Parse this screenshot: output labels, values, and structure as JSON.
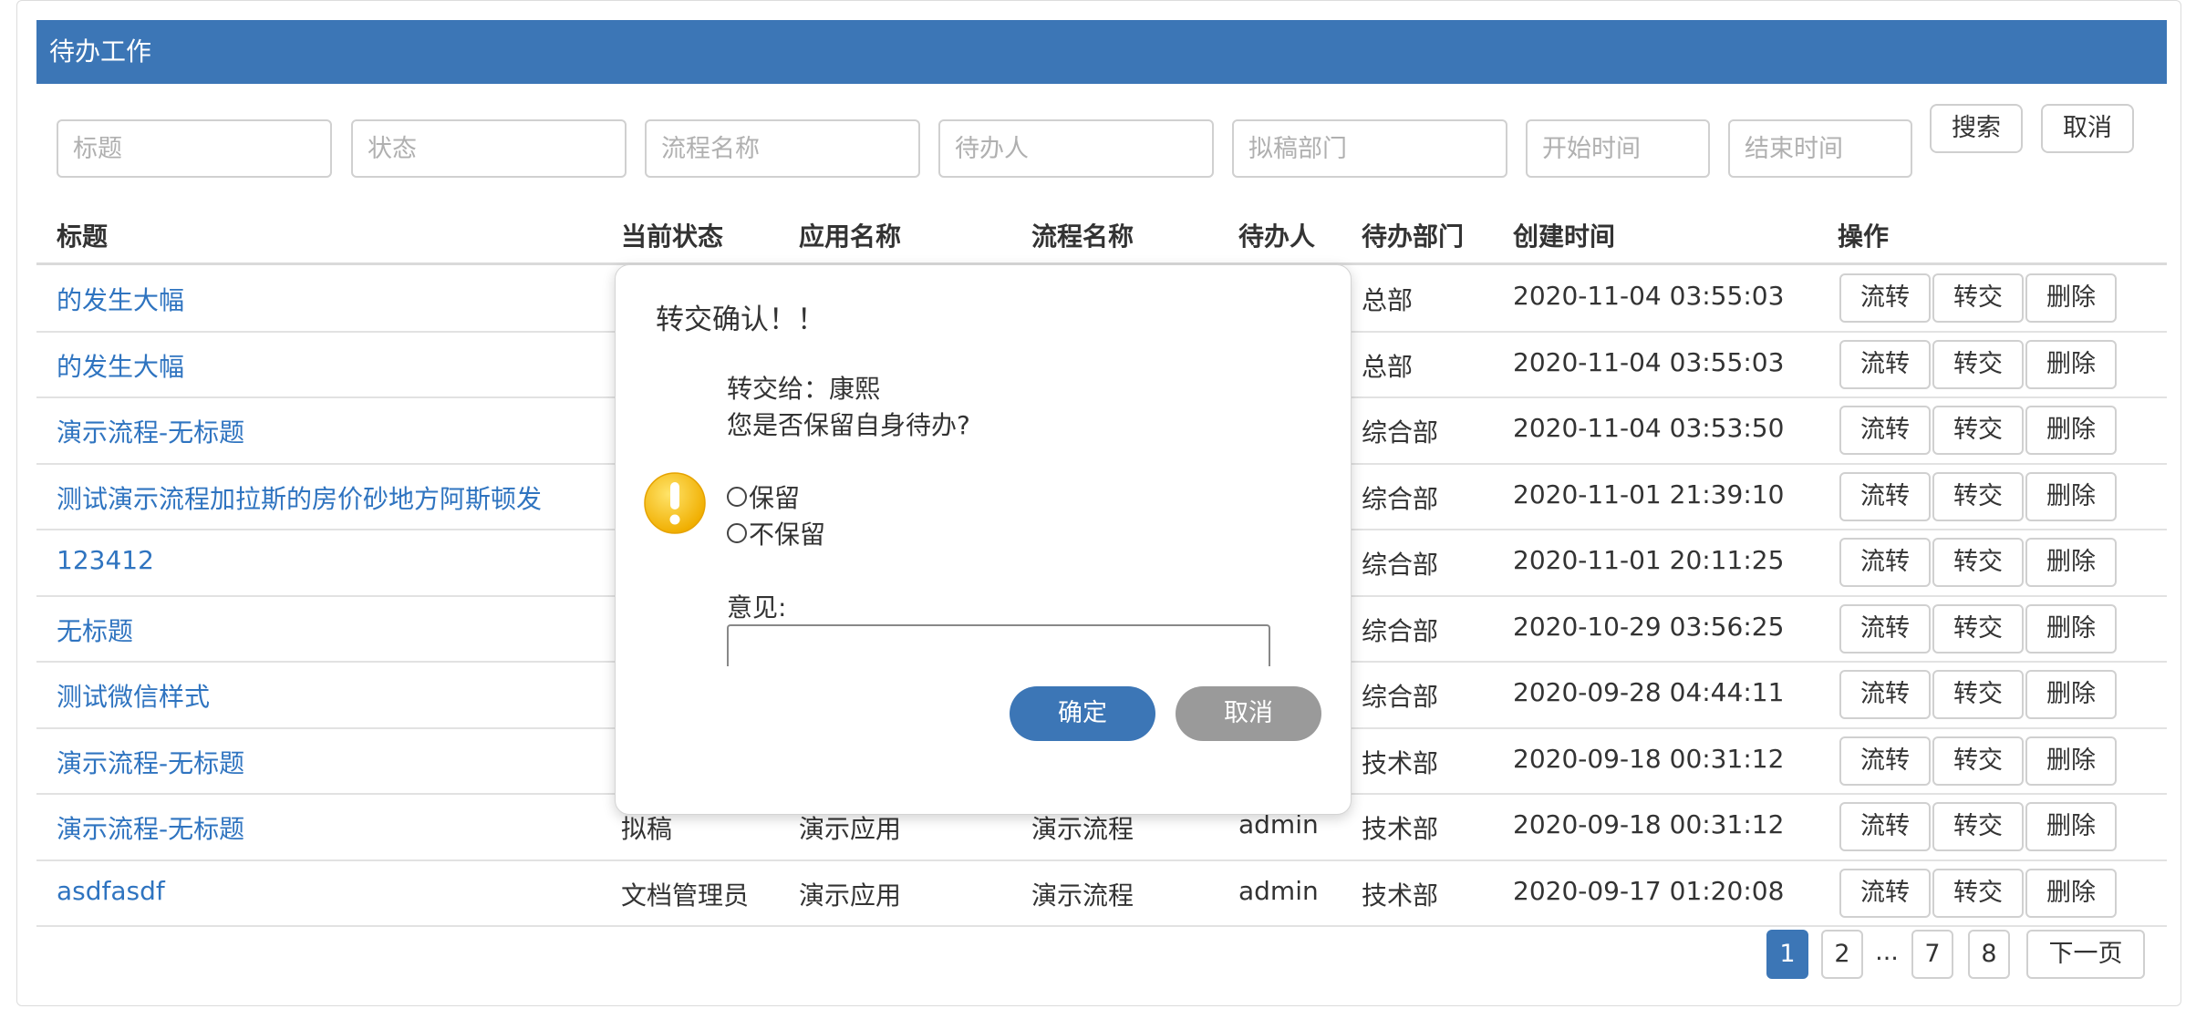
{
  "header": {
    "title": "待办工作"
  },
  "filters": {
    "title_placeholder": "标题",
    "status_placeholder": "状态",
    "flow_name_placeholder": "流程名称",
    "assignee_placeholder": "待办人",
    "draft_dept_placeholder": "拟稿部门",
    "start_time_placeholder": "开始时间",
    "end_time_placeholder": "结束时间",
    "search_label": "搜索",
    "cancel_label": "取消"
  },
  "table": {
    "columns": [
      "标题",
      "当前状态",
      "应用名称",
      "流程名称",
      "待办人",
      "待办部门",
      "创建时间",
      "操作"
    ],
    "rows": [
      {
        "title": "的发生大幅",
        "status": "",
        "app": "",
        "flow": "",
        "assignee": "",
        "dept": "总部",
        "created": "2020-11-04 03:55:03"
      },
      {
        "title": "的发生大幅",
        "status": "",
        "app": "",
        "flow": "",
        "assignee": "",
        "dept": "总部",
        "created": "2020-11-04 03:55:03"
      },
      {
        "title": "演示流程-无标题",
        "status": "",
        "app": "",
        "flow": "",
        "assignee": "",
        "dept": "综合部",
        "created": "2020-11-04 03:53:50"
      },
      {
        "title": "测试演示流程加拉斯的房价砂地方阿斯顿发",
        "status": "",
        "app": "",
        "flow": "",
        "assignee": "",
        "dept": "综合部",
        "created": "2020-11-01 21:39:10"
      },
      {
        "title": "123412",
        "status": "",
        "app": "",
        "flow": "",
        "assignee": "",
        "dept": "综合部",
        "created": "2020-11-01 20:11:25"
      },
      {
        "title": "无标题",
        "status": "",
        "app": "",
        "flow": "",
        "assignee": "",
        "dept": "综合部",
        "created": "2020-10-29 03:56:25"
      },
      {
        "title": "测试微信样式",
        "status": "",
        "app": "",
        "flow": "",
        "assignee": "",
        "dept": "综合部",
        "created": "2020-09-28 04:44:11"
      },
      {
        "title": "演示流程-无标题",
        "status": "",
        "app": "",
        "flow": "",
        "assignee": "",
        "dept": "技术部",
        "created": "2020-09-18 00:31:12"
      },
      {
        "title": "演示流程-无标题",
        "status": "拟稿",
        "app": "演示应用",
        "flow": "演示流程",
        "assignee": "admin",
        "dept": "技术部",
        "created": "2020-09-18 00:31:12"
      },
      {
        "title": "asdfasdf",
        "status": "文档管理员",
        "app": "演示应用",
        "flow": "演示流程",
        "assignee": "admin",
        "dept": "技术部",
        "created": "2020-09-17 01:20:08"
      }
    ],
    "actions": {
      "flow": "流转",
      "transfer": "转交",
      "delete": "删除"
    }
  },
  "pagination": {
    "pages": [
      "1",
      "2",
      "...",
      "7",
      "8"
    ],
    "next": "下一页",
    "current": "1"
  },
  "modal": {
    "title": "转交确认！！",
    "transfer_to": "转交给：康熙",
    "question": "您是否保留自身待办?",
    "option_keep": "保留",
    "option_not_keep": "不保留",
    "opinion_label": "意见:",
    "confirm_label": "确定",
    "cancel_label": "取消",
    "icon": "warning-icon"
  },
  "colors": {
    "brand": "#3c76b6",
    "link": "#2f74c0",
    "cancel_button": "#9a9a9a",
    "warning": "#f7c51c"
  }
}
